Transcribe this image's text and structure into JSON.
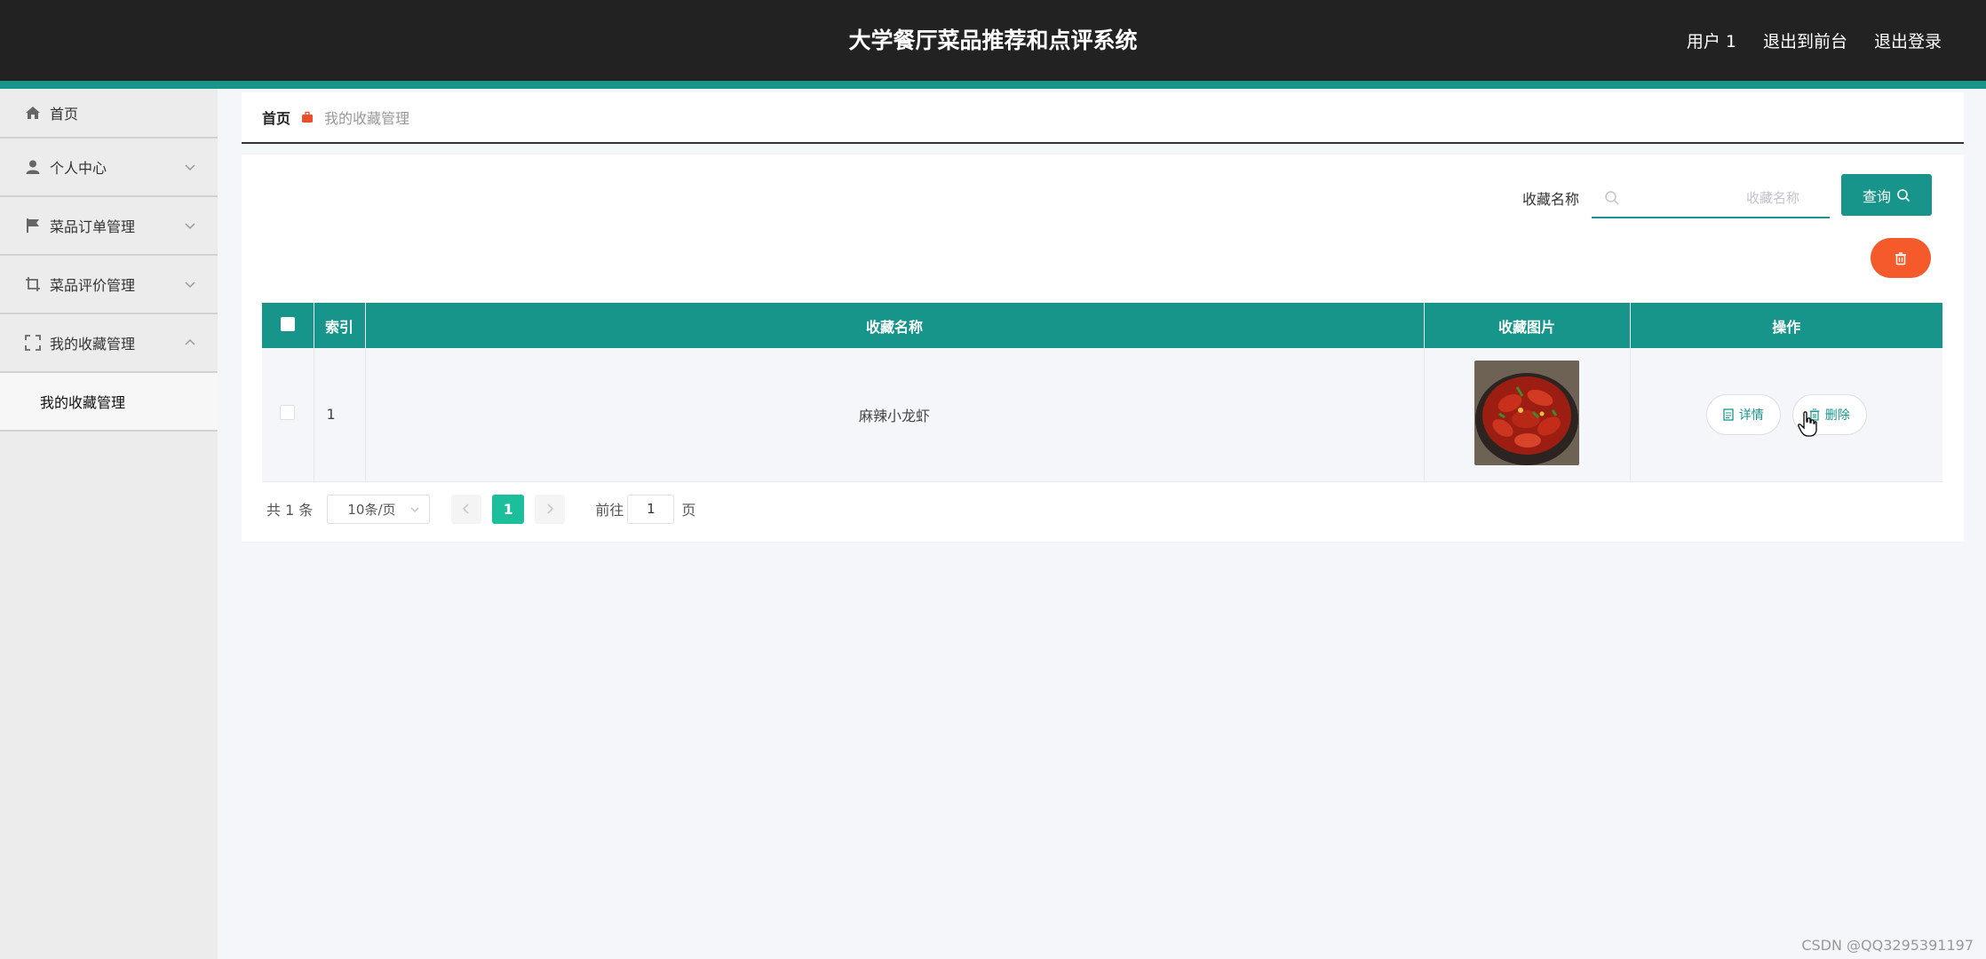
{
  "app": {
    "title": "大学餐厅菜品推荐和点评系统",
    "nav": {
      "user": "用户 1",
      "to_front": "退出到前台",
      "logout": "退出登录"
    },
    "accent_color": "#17958a",
    "danger_color": "#f45a2a"
  },
  "sidebar": {
    "items": [
      {
        "label": "首页",
        "icon": "home-icon"
      },
      {
        "label": "个人中心",
        "icon": "user-icon",
        "expanded": false
      },
      {
        "label": "菜品订单管理",
        "icon": "flag-icon",
        "expanded": false
      },
      {
        "label": "菜品评价管理",
        "icon": "crop-icon",
        "expanded": false
      },
      {
        "label": "我的收藏管理",
        "icon": "fullscreen-icon",
        "expanded": true
      }
    ],
    "subitems": [
      {
        "label": "我的收藏管理"
      }
    ]
  },
  "breadcrumb": {
    "home": "首页",
    "current": "我的收藏管理"
  },
  "search": {
    "label": "收藏名称",
    "placeholder": "收藏名称",
    "value": "",
    "button": "查询"
  },
  "table": {
    "headers": {
      "index": "索引",
      "name": "收藏名称",
      "image": "收藏图片",
      "actions": "操作"
    },
    "rows": [
      {
        "index": "1",
        "name": "麻辣小龙虾",
        "image": "crawfish-photo",
        "detail": "详情",
        "delete": "删除"
      }
    ]
  },
  "pagination": {
    "total": "共 1 条",
    "page_size": "10条/页",
    "current_page": "1",
    "goto_label": "前往",
    "goto_value": "1",
    "page_unit": "页"
  },
  "watermark": "CSDN @QQ3295391197"
}
